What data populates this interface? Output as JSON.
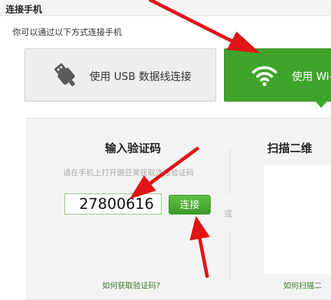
{
  "window": {
    "title": "连接手机"
  },
  "subtitle": "你可以通过以下方式连接手机",
  "options": {
    "usb": {
      "label": "使用 USB 数据线连接",
      "icon": "usb-icon"
    },
    "wifi": {
      "label": "使用 Wi-",
      "icon": "wifi-icon"
    }
  },
  "code_section": {
    "title": "输入验证码",
    "hint": "请在手机上打开豌豆荚获取连接验证码",
    "input_value": "27800616",
    "connect_label": "连接",
    "help_link": "如何获取验证码?"
  },
  "separator": "或",
  "scan_section": {
    "title": "扫描二维",
    "help_link": "如何扫描二"
  },
  "colors": {
    "accent_green": "#3fa42b",
    "annotation_red": "#e01515"
  }
}
